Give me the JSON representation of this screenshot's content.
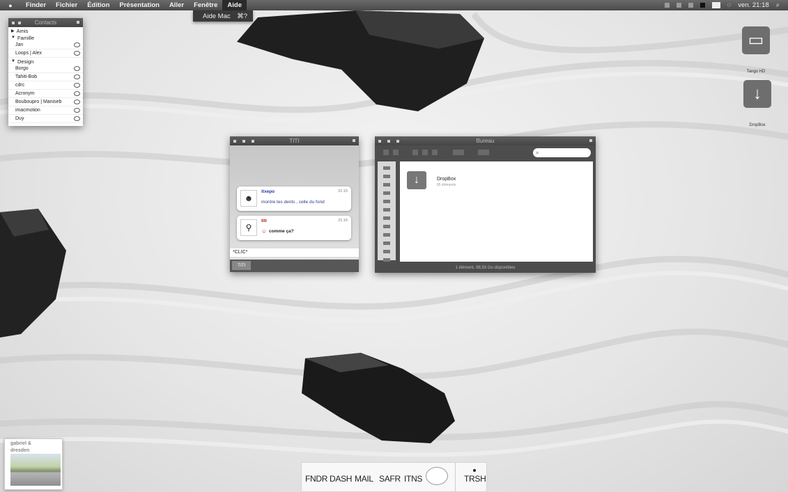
{
  "menubar": {
    "apple": "",
    "items": [
      "Finder",
      "Fichier",
      "Édition",
      "Présentation",
      "Aller",
      "Fenêtre",
      "Aide"
    ],
    "clock": "ven. 21:18"
  },
  "dropdown": {
    "label": "Aide Mac",
    "shortcut": "⌘?"
  },
  "contacts": {
    "title": "Contacts",
    "groups": [
      {
        "name": "Amis",
        "expanded": false,
        "members": []
      },
      {
        "name": "Famille",
        "expanded": true,
        "members": [
          "Jan",
          "Loops | Alex"
        ]
      },
      {
        "name": "Design",
        "expanded": true,
        "members": [
          "Borgo",
          "Tahiti-Bob",
          "cdrc",
          "Acronym",
          "Bouboupro | Maniseb",
          "imacmotion",
          "Duy"
        ]
      }
    ]
  },
  "chat": {
    "title": "TITI",
    "messages": [
      {
        "name": "itxepo",
        "time": "21:15",
        "text": "montre tes dents , celle du fond",
        "name_color": "#1c3aa8"
      },
      {
        "name": "titi",
        "time": "21:16",
        "text": "comme ça?",
        "name_color": "#b0101c"
      }
    ],
    "input": "*CLIC*",
    "tab": "TITI"
  },
  "finder": {
    "title": "Bureau",
    "item_name": "DropBox",
    "item_sub": "85 éléments",
    "status": "1 élément, 98,93 Go disponibles"
  },
  "desktop": {
    "hd_label": "Tango HD",
    "dropbox_label": "DropBox"
  },
  "album": {
    "line1": "gabriel &",
    "line2": "dresden"
  },
  "dock": {
    "items": [
      "FNDR",
      "DASH",
      "MAIL",
      "SAFR",
      "ITNS"
    ],
    "trash": "TRSH"
  }
}
